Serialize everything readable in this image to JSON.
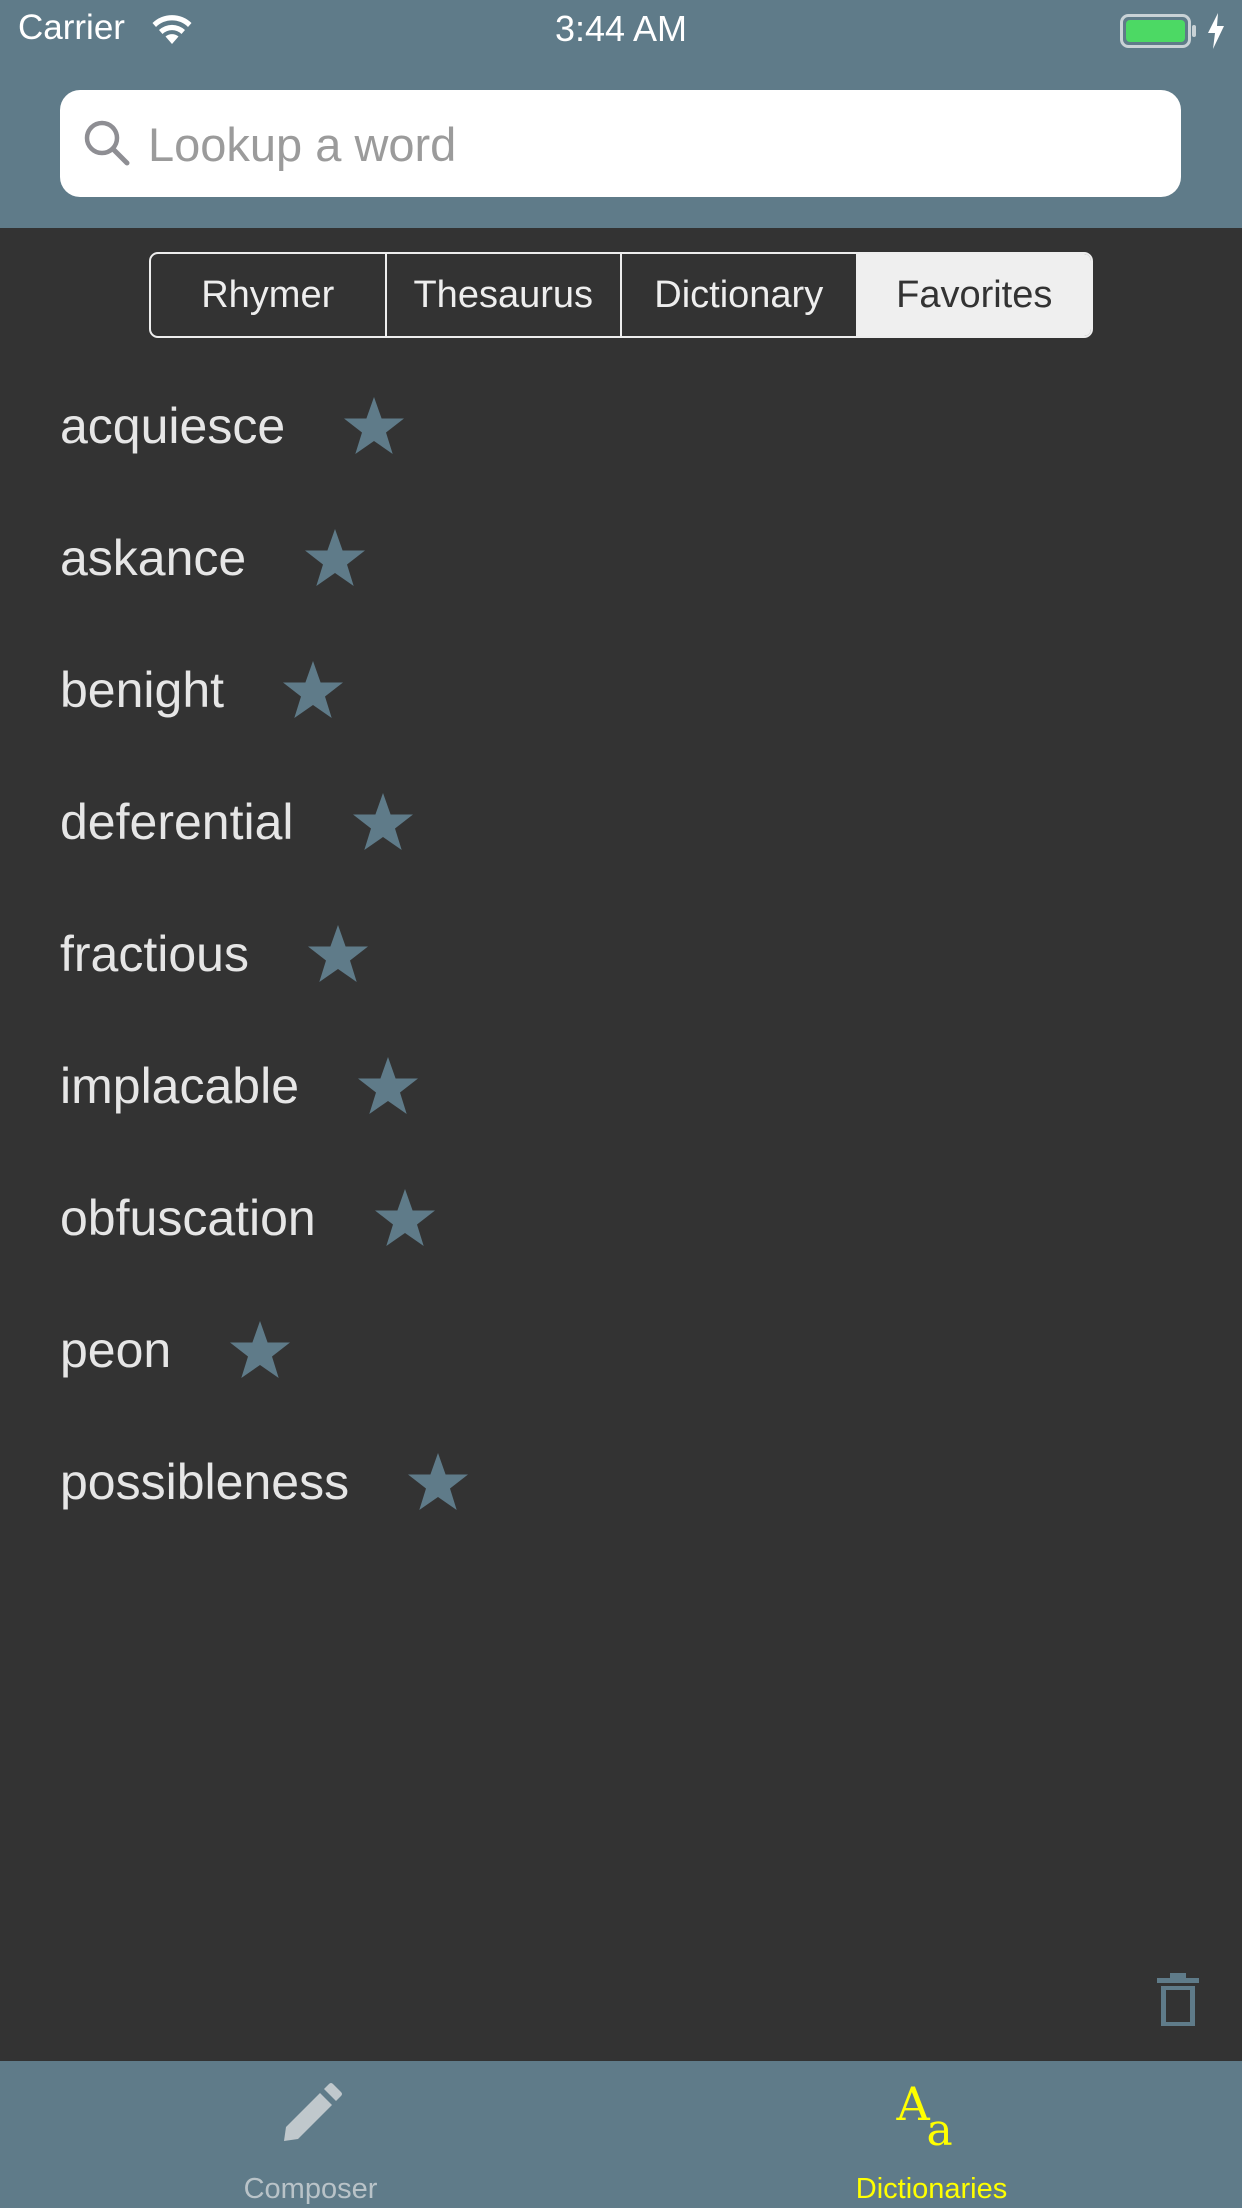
{
  "status_bar": {
    "carrier": "Carrier",
    "time": "3:44 AM",
    "battery_charging": true
  },
  "search": {
    "placeholder": "Lookup a word",
    "value": ""
  },
  "segments": [
    {
      "label": "Rhymer",
      "selected": false
    },
    {
      "label": "Thesaurus",
      "selected": false
    },
    {
      "label": "Dictionary",
      "selected": false
    },
    {
      "label": "Favorites",
      "selected": true
    }
  ],
  "favorites": [
    {
      "word": "acquiesce",
      "icon": "star-icon"
    },
    {
      "word": "askance",
      "icon": "star-icon"
    },
    {
      "word": "benight",
      "icon": "star-icon"
    },
    {
      "word": "deferential",
      "icon": "star-icon"
    },
    {
      "word": "fractious",
      "icon": "star-icon"
    },
    {
      "word": "implacable",
      "icon": "star-icon"
    },
    {
      "word": "obfuscation",
      "icon": "star-icon"
    },
    {
      "word": "peon",
      "icon": "star-icon"
    },
    {
      "word": "possibleness",
      "icon": "star-icon"
    }
  ],
  "actions": {
    "delete_icon": "trash-icon"
  },
  "tabbar": {
    "tabs": [
      {
        "label": "Composer",
        "icon": "pencil-icon",
        "selected": false
      },
      {
        "label": "Dictionaries",
        "icon": "dictionary-aa-icon",
        "selected": true
      }
    ]
  },
  "colors": {
    "bar_background": "#5f7b89",
    "content_background": "#333333",
    "star": "#5f7b89",
    "selected_tab": "#ffff00",
    "battery_fill": "#4cd964"
  }
}
